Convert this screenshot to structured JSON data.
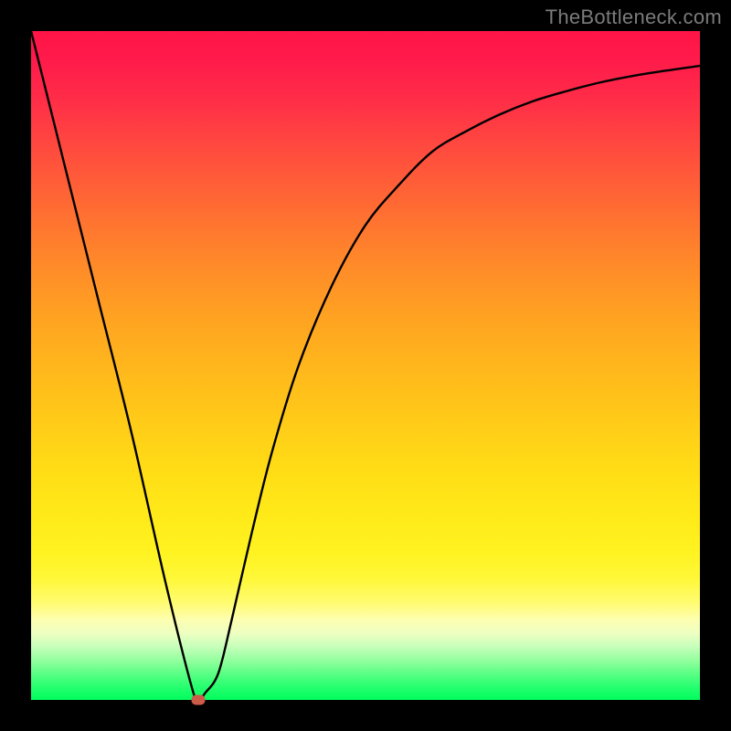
{
  "watermark": "TheBottleneck.com",
  "chart_data": {
    "type": "line",
    "title": "",
    "xlabel": "",
    "ylabel": "",
    "xlim": [
      0,
      100
    ],
    "ylim": [
      0,
      100
    ],
    "grid": false,
    "legend": false,
    "series": [
      {
        "name": "curve",
        "x": [
          0,
          5,
          10,
          15,
          20,
          24,
          25,
          26,
          28,
          30,
          33,
          36,
          40,
          45,
          50,
          55,
          60,
          65,
          70,
          75,
          80,
          85,
          90,
          95,
          100
        ],
        "y": [
          100,
          80,
          60,
          40,
          18,
          2,
          0,
          1,
          4,
          12,
          25,
          37,
          50,
          62,
          71,
          77,
          82,
          85,
          87.5,
          89.5,
          91,
          92.3,
          93.3,
          94.1,
          94.8
        ]
      }
    ],
    "marker": {
      "x": 25,
      "y": 0
    },
    "gradient_stops": [
      {
        "pos": 0,
        "color": "#ff1446"
      },
      {
        "pos": 50,
        "color": "#ffb61c"
      },
      {
        "pos": 82,
        "color": "#fff83a"
      },
      {
        "pos": 100,
        "color": "#00fd5d"
      }
    ]
  }
}
